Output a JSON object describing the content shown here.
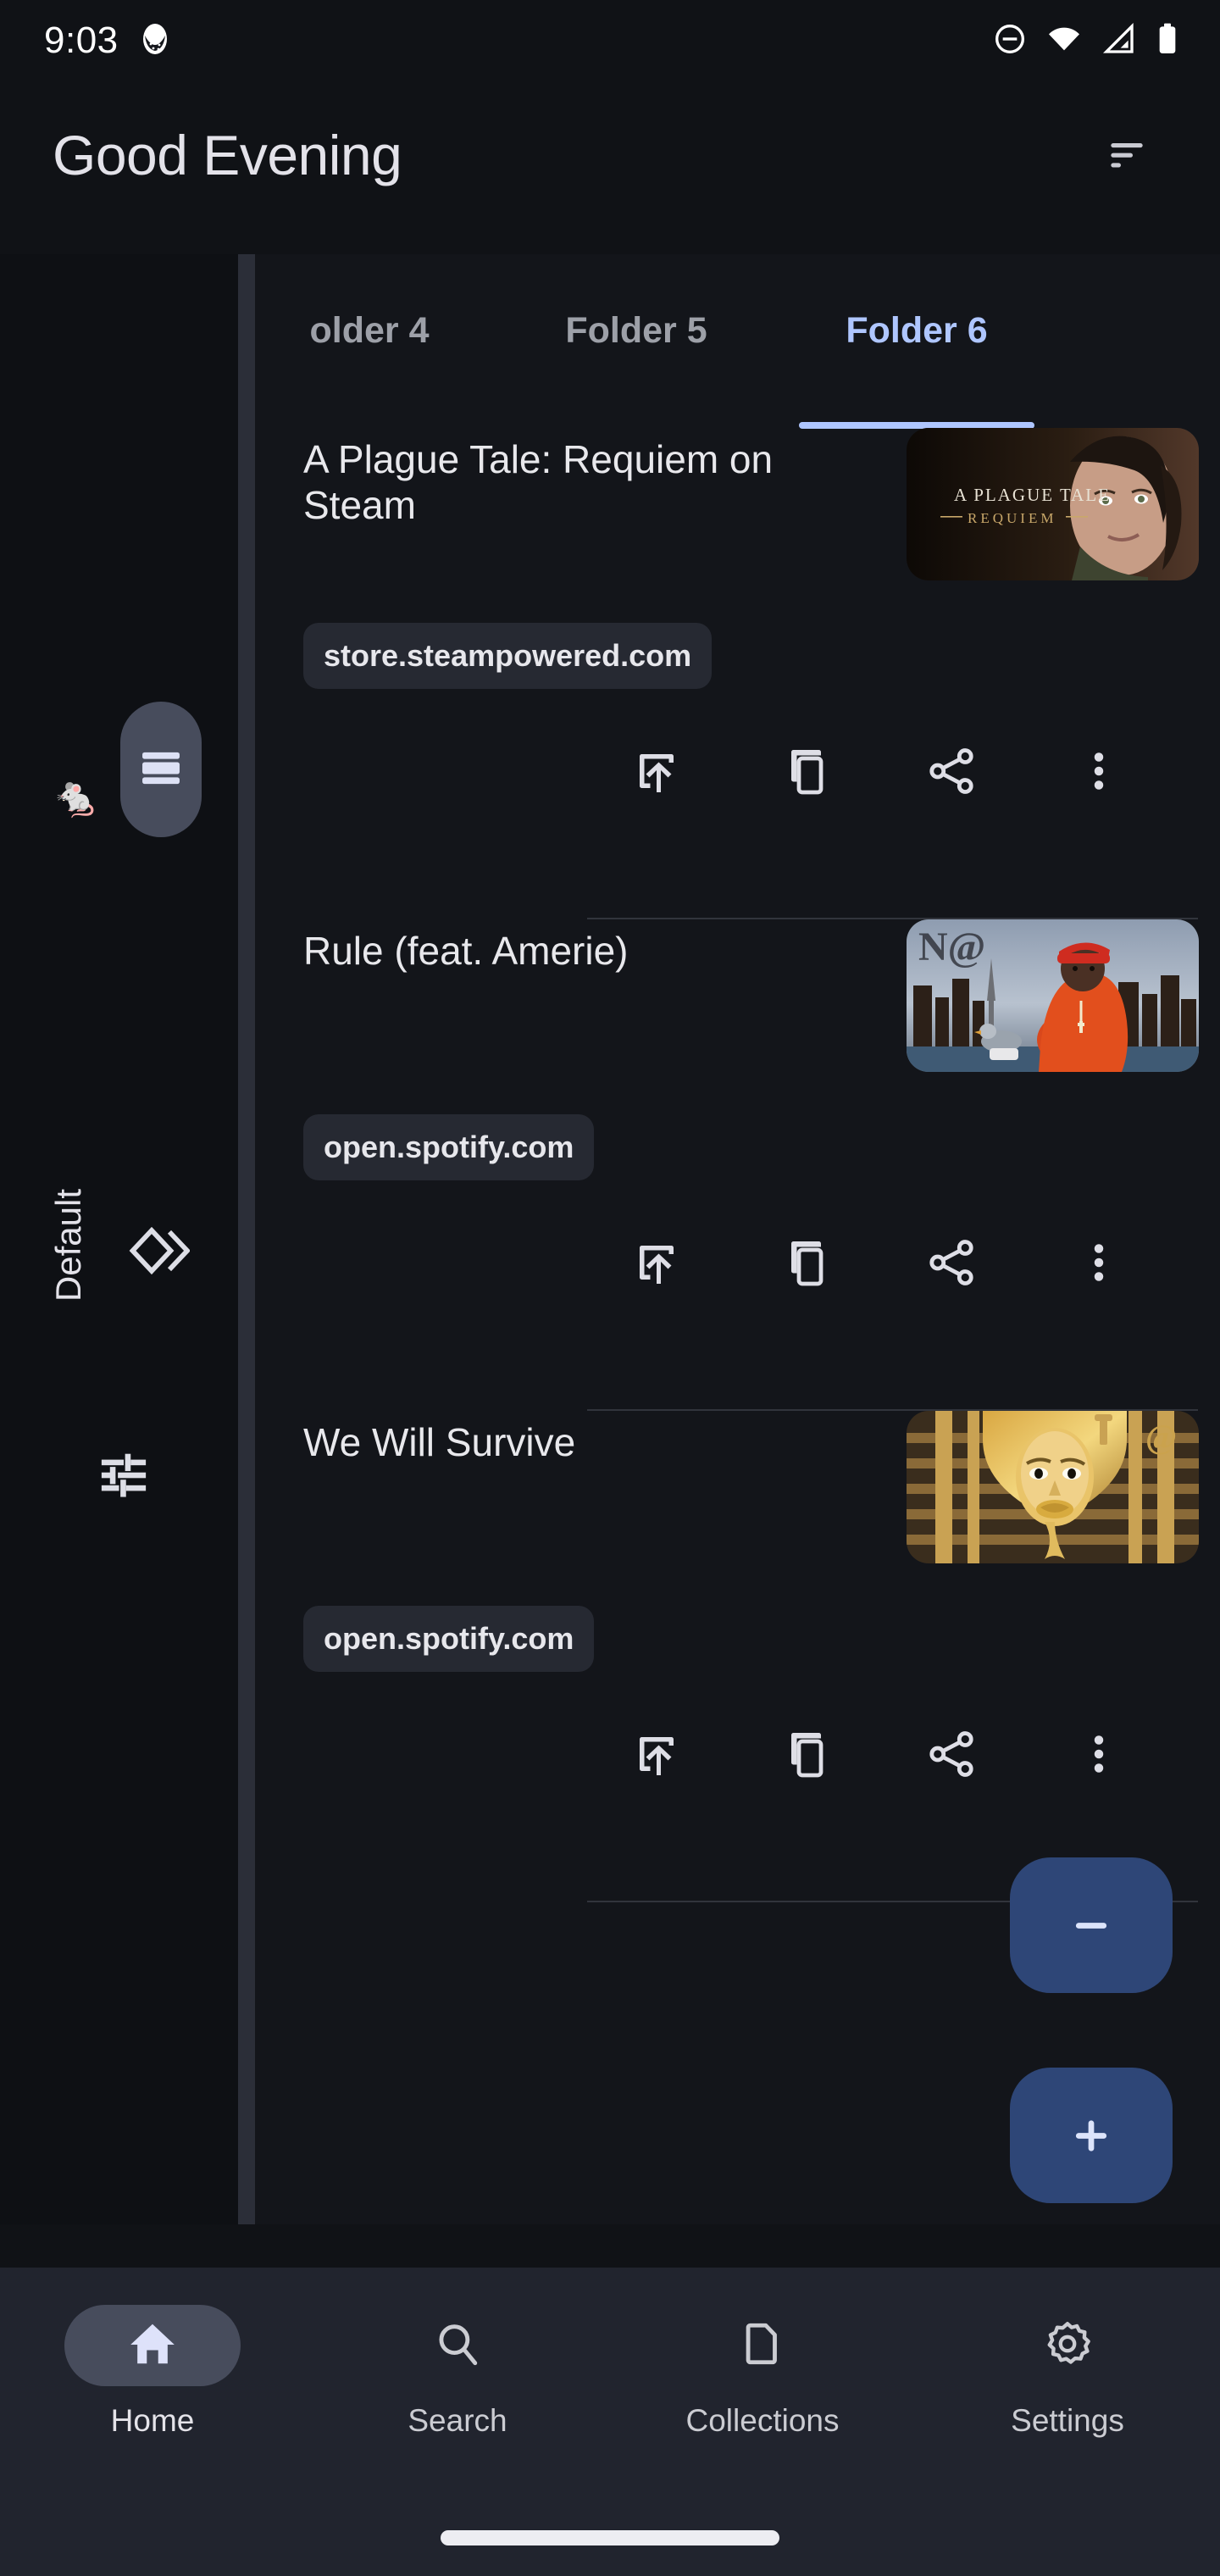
{
  "status_bar": {
    "time": "9:03",
    "left_icons": [
      "chicken-emoji-icon"
    ],
    "right_icons": [
      "do-not-disturb-icon",
      "wifi-icon",
      "cellular-signal-icon",
      "battery-icon"
    ]
  },
  "app_bar": {
    "title": "Good Evening",
    "menu_icon": "sort-filter-icon"
  },
  "drawer": {
    "items": [
      {
        "name": "mouse-emoji",
        "glyph": "🐁",
        "selected": false
      },
      {
        "name": "view-agenda",
        "icon": "view-agenda-icon",
        "selected": true
      },
      {
        "name": "default-label",
        "label": "Default",
        "selected": false
      },
      {
        "name": "diamond-chevron",
        "icon": "diamond-chevron-icon",
        "selected": false
      },
      {
        "name": "tune",
        "icon": "tune-icon",
        "selected": false
      }
    ]
  },
  "tabs": {
    "items": [
      {
        "label": "older 4",
        "active": false
      },
      {
        "label": "Folder 5",
        "active": false
      },
      {
        "label": "Folder 6",
        "active": true
      }
    ],
    "active_index": 2,
    "active_color": "#AFC6FF",
    "inactive_color": "#9DA0A8"
  },
  "list": {
    "items": [
      {
        "title": "A Plague Tale: Requiem on Steam",
        "domain": "store.steampowered.com",
        "thumb": "plague-tale-requiem-cover",
        "actions": [
          "open-in-new-icon",
          "copy-icon",
          "share-icon",
          "more-vert-icon"
        ]
      },
      {
        "title": "Rule (feat. Amerie)",
        "domain": "open.spotify.com",
        "thumb": "nas-album-cover",
        "actions": [
          "open-in-new-icon",
          "copy-icon",
          "share-icon",
          "more-vert-icon"
        ]
      },
      {
        "title": "We Will Survive",
        "domain": "open.spotify.com",
        "thumb": "pharaoh-album-cover",
        "actions": [
          "open-in-new-icon",
          "copy-icon",
          "share-icon",
          "more-vert-icon"
        ]
      }
    ]
  },
  "fabs": [
    {
      "name": "remove-fab",
      "icon": "minus-icon",
      "color": "#2E4677"
    },
    {
      "name": "add-fab",
      "icon": "plus-icon",
      "color": "#2E4677"
    }
  ],
  "bottom_nav": {
    "items": [
      {
        "label": "Home",
        "icon": "home-icon",
        "active": true
      },
      {
        "label": "Search",
        "icon": "search-icon",
        "active": false
      },
      {
        "label": "Collections",
        "icon": "folder-icon",
        "active": false
      },
      {
        "label": "Settings",
        "icon": "gear-icon",
        "active": false
      }
    ]
  }
}
